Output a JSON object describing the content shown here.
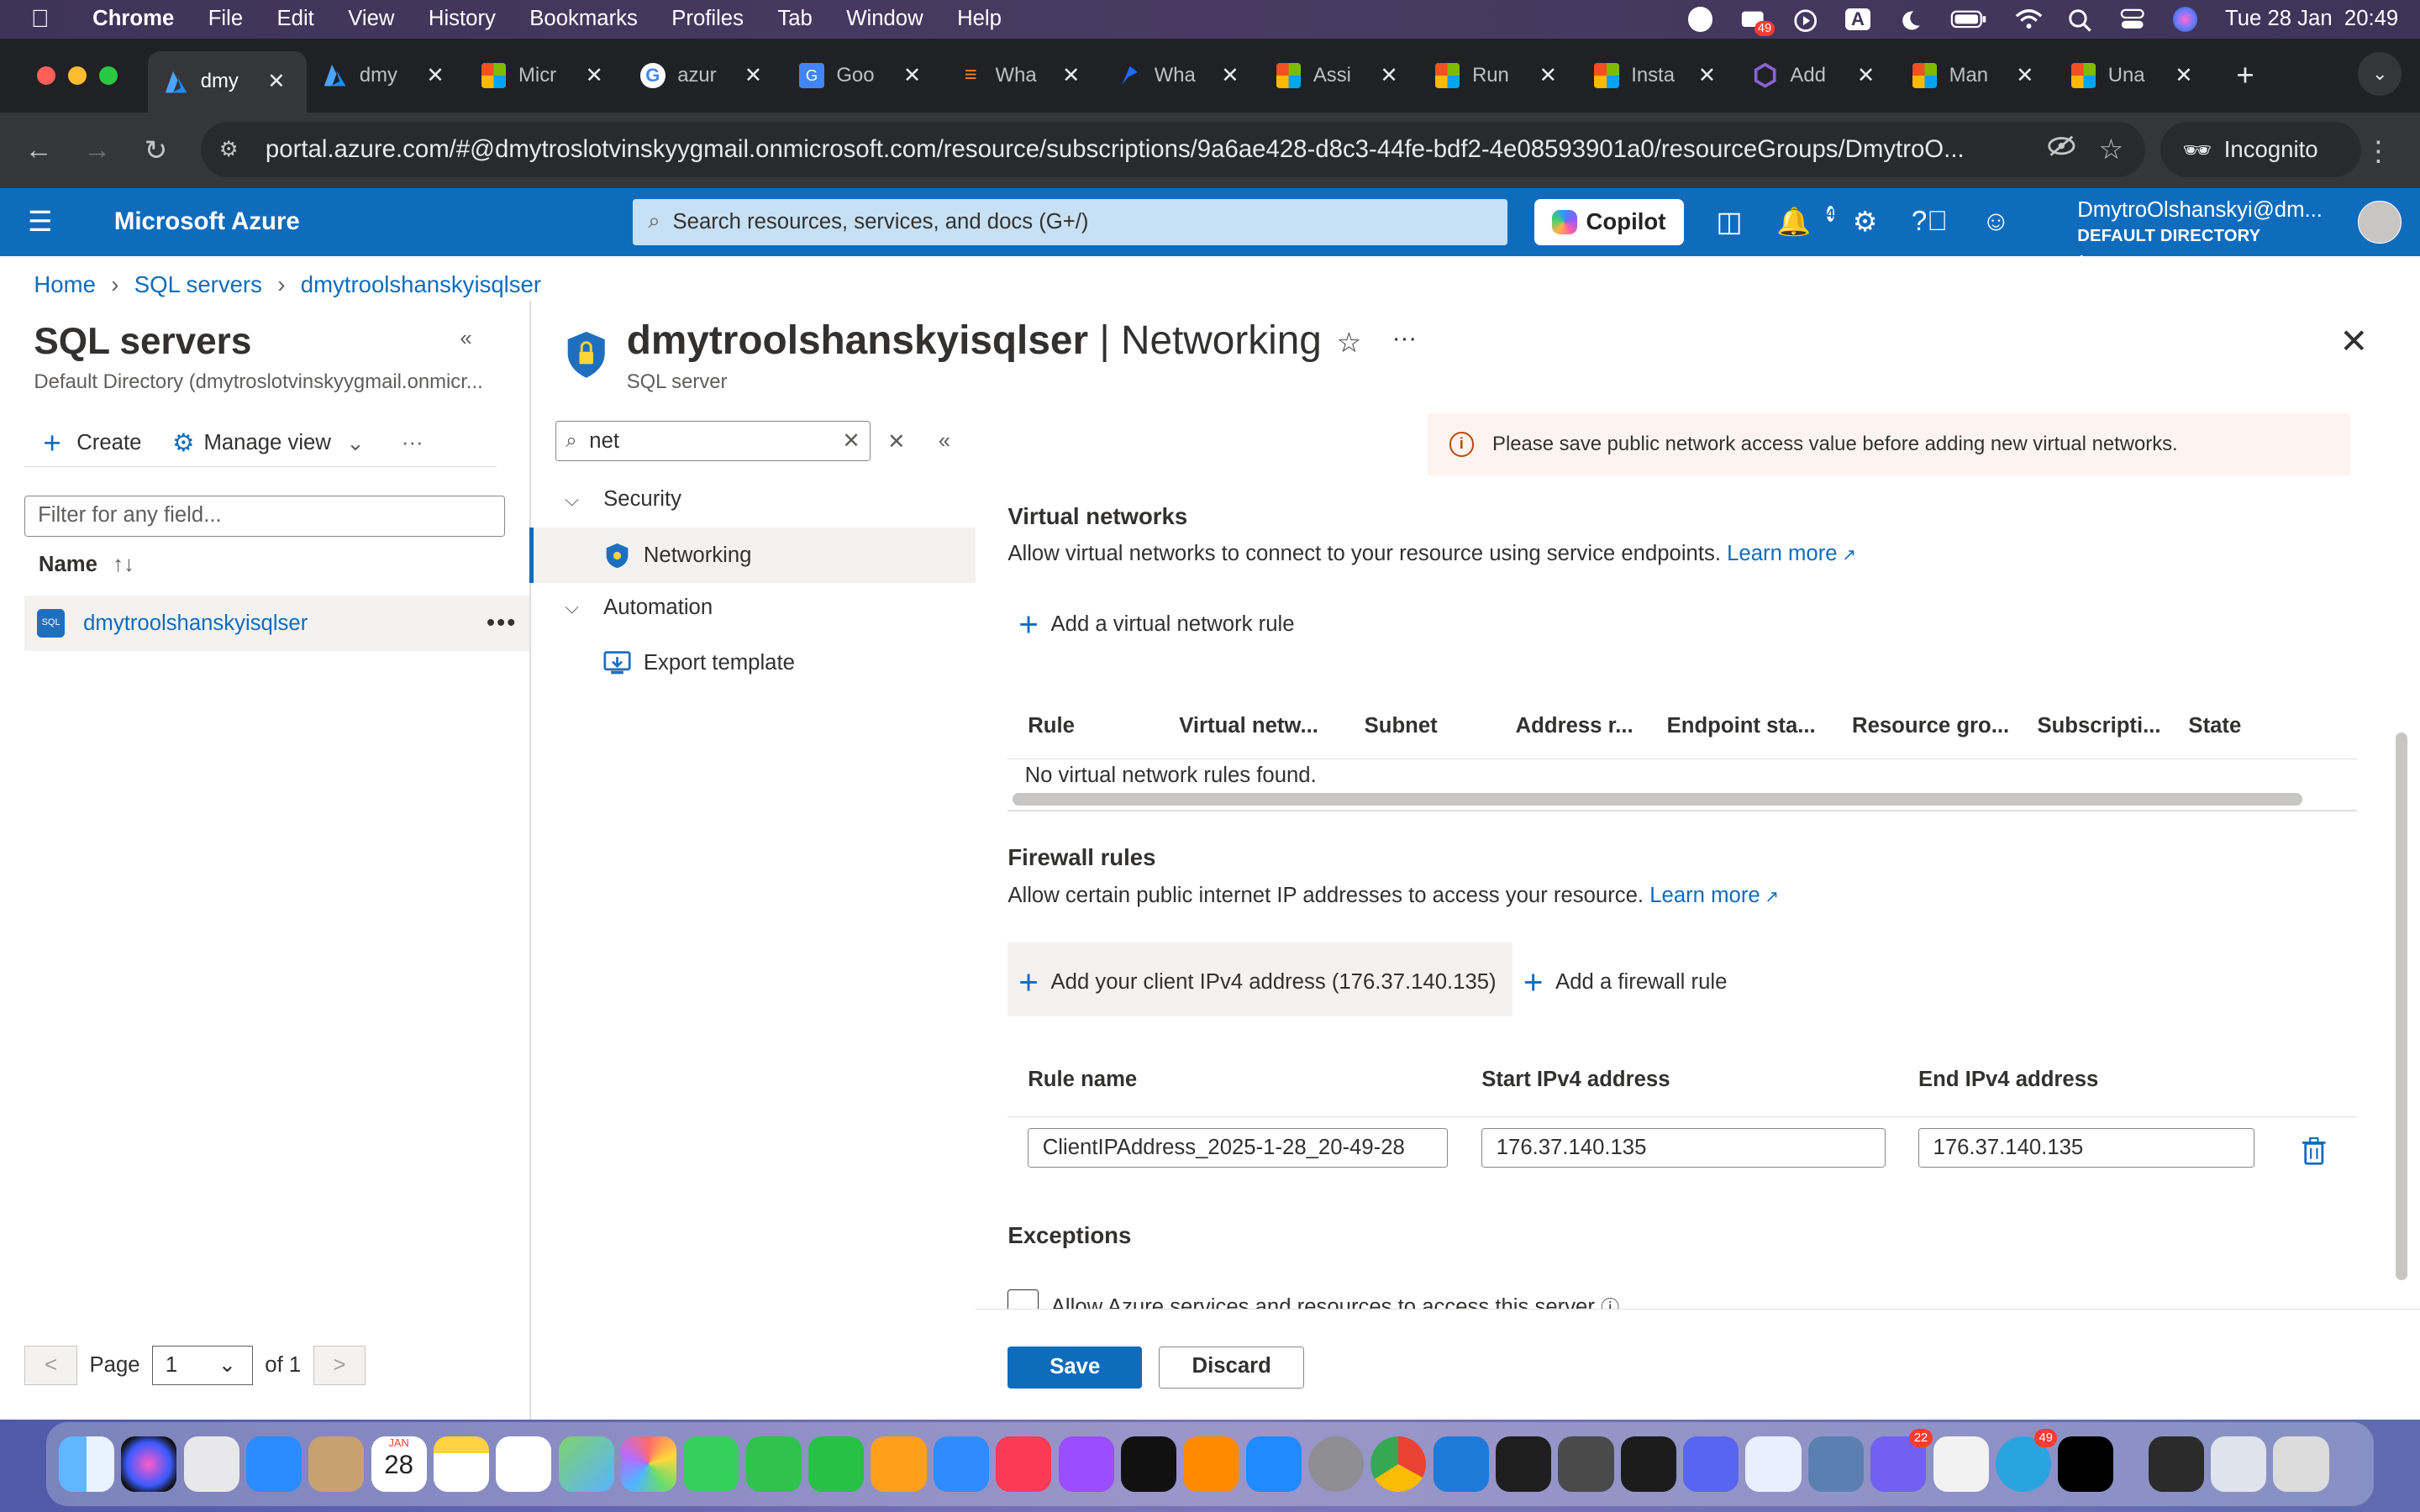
{
  "macos_menubar": {
    "app": "Chrome",
    "items": [
      "File",
      "Edit",
      "View",
      "History",
      "Bookmarks",
      "Profiles",
      "Tab",
      "Window",
      "Help"
    ],
    "battery_badge": "49",
    "datetime": "Tue 28 Jan  20:49"
  },
  "browser": {
    "tabs": [
      {
        "title": "dmy",
        "active": true,
        "favicon": "azure-icon"
      },
      {
        "title": "dmy",
        "favicon": "azure-icon"
      },
      {
        "title": "Micr",
        "favicon": "microsoft-icon"
      },
      {
        "title": "azur",
        "favicon": "google-icon"
      },
      {
        "title": "Goo",
        "favicon": "google-translate-icon"
      },
      {
        "title": "Wha",
        "favicon": "stackoverflow-icon"
      },
      {
        "title": "Wha",
        "favicon": "bluesky-icon"
      },
      {
        "title": "Assi",
        "favicon": "microsoft-icon"
      },
      {
        "title": "Run",
        "favicon": "microsoft-icon"
      },
      {
        "title": "Insta",
        "favicon": "microsoft-icon"
      },
      {
        "title": "Add",
        "favicon": "purple-hex-icon"
      },
      {
        "title": "Man",
        "favicon": "microsoft-icon"
      },
      {
        "title": "Una",
        "favicon": "microsoft-icon"
      }
    ],
    "url": "portal.azure.com/#@dmytroslotvinskyygmail.onmicrosoft.com/resource/subscriptions/9a6ae428-d8c3-44fe-bdf2-4e08593901a0/resourceGroups/DmytroO...",
    "profile_label": "Incognito"
  },
  "azure_header": {
    "brand": "Microsoft Azure",
    "search_placeholder": "Search resources, services, and docs (G+/)",
    "copilot_label": "Copilot",
    "notification_count": "4",
    "account_name": "DmytroOlshanskyi@dm...",
    "account_directory": "DEFAULT DIRECTORY (DMYTROS..."
  },
  "breadcrumb": [
    "Home",
    "SQL servers",
    "dmytroolshanskyisqlser"
  ],
  "left_pane": {
    "title": "SQL servers",
    "subtitle": "Default Directory (dmytroslotvinskyygmail.onmicr...",
    "create_label": "Create",
    "manage_view_label": "Manage view",
    "filter_placeholder": "Filter for any field...",
    "column_name": "Name",
    "rows": [
      {
        "name": "dmytroolshanskyisqlser"
      }
    ],
    "pager": {
      "page_label": "Page",
      "page_value": "1",
      "of_label": "of 1"
    }
  },
  "resource": {
    "name": "dmytroolshanskyisqlser",
    "section": "| Networking",
    "type": "SQL server"
  },
  "resource_menu": {
    "search_value": "net",
    "groups": [
      {
        "label": "Security",
        "items": [
          {
            "label": "Networking",
            "selected": true
          }
        ]
      },
      {
        "label": "Automation",
        "items": [
          {
            "label": "Export template"
          }
        ]
      }
    ]
  },
  "networking": {
    "info_message": "Please save public network access value before adding new virtual networks.",
    "vnet": {
      "heading": "Virtual networks",
      "description": "Allow virtual networks to connect to your resource using service endpoints.",
      "learn_more": "Learn more",
      "add_label": "Add a virtual network rule",
      "columns": [
        "Rule",
        "Virtual netw...",
        "Subnet",
        "Address r...",
        "Endpoint sta...",
        "Resource gro...",
        "Subscripti...",
        "State"
      ],
      "empty_text": "No virtual network rules found."
    },
    "firewall": {
      "heading": "Firewall rules",
      "description": "Allow certain public internet IP addresses to access your resource.",
      "learn_more": "Learn more",
      "add_client_label": "Add your client IPv4 address (176.37.140.135)",
      "add_rule_label": "Add a firewall rule",
      "columns": [
        "Rule name",
        "Start IPv4 address",
        "End IPv4 address"
      ],
      "rules": [
        {
          "name": "ClientIPAddress_2025-1-28_20-49-28",
          "start": "176.37.140.135",
          "end": "176.37.140.135"
        }
      ]
    },
    "exceptions": {
      "heading": "Exceptions",
      "allow_azure_label": "Allow Azure services and resources to access this server",
      "allow_azure_checked": false
    },
    "save_label": "Save",
    "discard_label": "Discard"
  },
  "dock": {
    "calendar_month": "JAN",
    "calendar_day": "28",
    "badges": {
      "viber": "22",
      "telegram": "49"
    }
  },
  "colors": {
    "azure_blue": "#0f6cbd",
    "chrome_dark": "#202124",
    "info_bg": "#fdf3f0"
  }
}
